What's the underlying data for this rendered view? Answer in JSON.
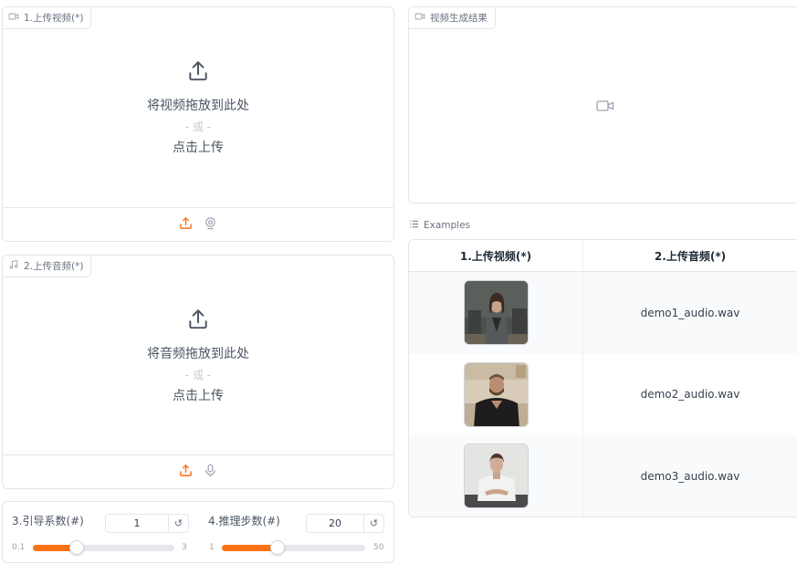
{
  "video_upload": {
    "label": "1.上传视频(*)",
    "drop_text": "将视频拖放到此处",
    "or_text": "- 或 -",
    "click_text": "点击上传"
  },
  "audio_upload": {
    "label": "2.上传音频(*)",
    "drop_text": "将音频拖放到此处",
    "or_text": "- 或 -",
    "click_text": "点击上传"
  },
  "guidance": {
    "label": "3.引导系数(#)",
    "value": "1",
    "min": "0.1",
    "max": "3",
    "level": 0.31,
    "reset_glyph": "↺"
  },
  "steps": {
    "label": "4.推理步数(#)",
    "value": "20",
    "min": "1",
    "max": "50",
    "level": 0.39,
    "reset_glyph": "↺"
  },
  "result": {
    "label": "视频生成结果"
  },
  "examples": {
    "label": "Examples",
    "headers": [
      "1.上传视频(*)",
      "2.上传音频(*)"
    ],
    "rows": [
      {
        "audio": "demo1_audio.wav"
      },
      {
        "audio": "demo2_audio.wav"
      },
      {
        "audio": "demo3_audio.wav"
      }
    ]
  },
  "colors": {
    "accent": "#f97316",
    "border": "#e5e7eb",
    "muted_text": "#6b7280"
  },
  "icons": {
    "video_label": "video-camera-icon",
    "audio_label": "music-note-icon",
    "upload": "upload-icon",
    "webcam": "webcam-icon",
    "microphone": "microphone-icon",
    "result_placeholder": "video-camera-icon",
    "examples": "list-icon"
  }
}
